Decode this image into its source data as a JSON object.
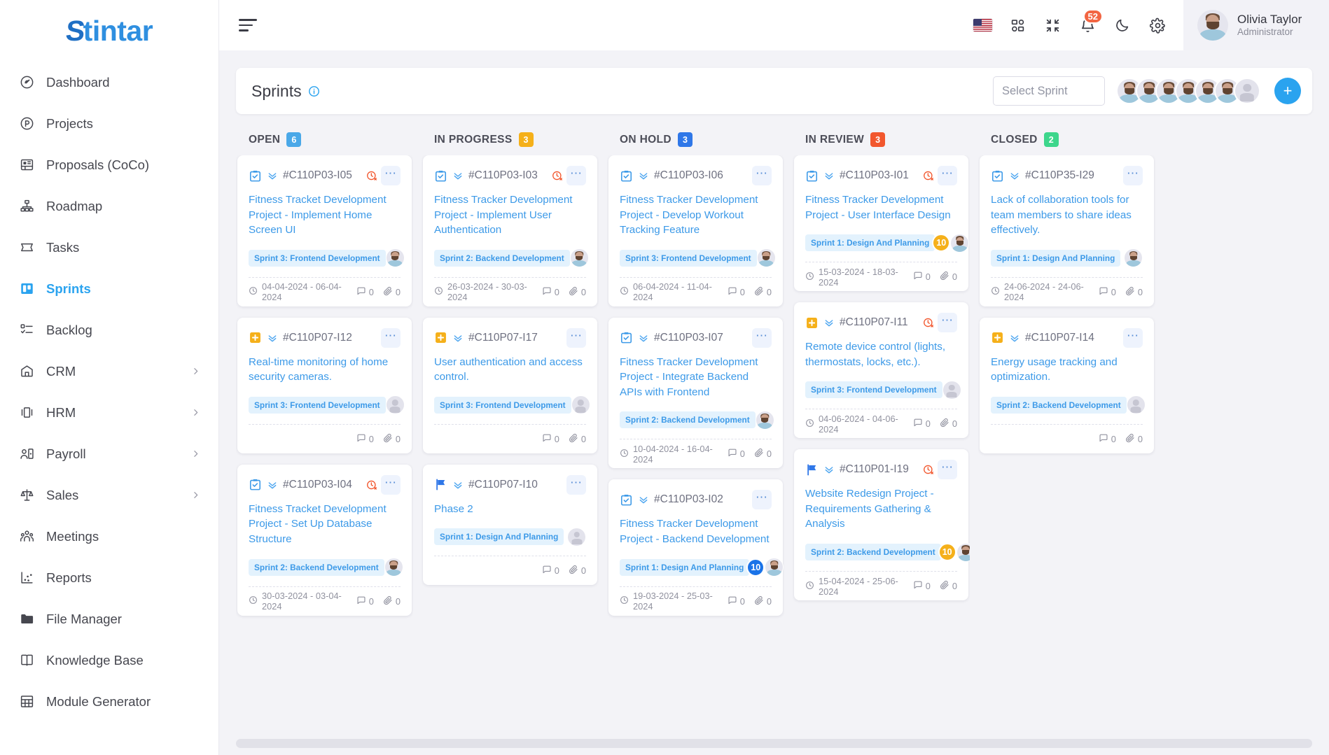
{
  "brand": {
    "logo_mark": "S",
    "logo_text": "tintar",
    "accent": "#2aa3ef"
  },
  "sidebar": {
    "items": [
      {
        "label": "Dashboard",
        "icon": "speedometer-icon",
        "active": false,
        "expandable": false
      },
      {
        "label": "Projects",
        "icon": "projects-icon",
        "active": false,
        "expandable": false
      },
      {
        "label": "Proposals (CoCo)",
        "icon": "proposals-icon",
        "active": false,
        "expandable": false
      },
      {
        "label": "Roadmap",
        "icon": "roadmap-icon",
        "active": false,
        "expandable": false
      },
      {
        "label": "Tasks",
        "icon": "tasks-icon",
        "active": false,
        "expandable": false
      },
      {
        "label": "Sprints",
        "icon": "sprints-board-icon",
        "active": true,
        "expandable": false
      },
      {
        "label": "Backlog",
        "icon": "backlog-icon",
        "active": false,
        "expandable": false
      },
      {
        "label": "CRM",
        "icon": "crm-icon",
        "active": false,
        "expandable": true
      },
      {
        "label": "HRM",
        "icon": "hrm-icon",
        "active": false,
        "expandable": true
      },
      {
        "label": "Payroll",
        "icon": "payroll-icon",
        "active": false,
        "expandable": true
      },
      {
        "label": "Sales",
        "icon": "sales-scale-icon",
        "active": false,
        "expandable": true
      },
      {
        "label": "Meetings",
        "icon": "meetings-icon",
        "active": false,
        "expandable": false
      },
      {
        "label": "Reports",
        "icon": "reports-icon",
        "active": false,
        "expandable": false
      },
      {
        "label": "File Manager",
        "icon": "folder-icon",
        "active": false,
        "expandable": false
      },
      {
        "label": "Knowledge Base",
        "icon": "knowledge-base-icon",
        "active": false,
        "expandable": false
      },
      {
        "label": "Module Generator",
        "icon": "module-generator-icon",
        "active": false,
        "expandable": false
      }
    ]
  },
  "topbar": {
    "menu_toggle": "hamburger-icon",
    "language_flag": "us-flag-icon",
    "apps_icon": "grid-apps-icon",
    "fullscreen_icon": "compress-icon",
    "notifications_icon": "bell-icon",
    "notifications_count": "52",
    "dark_mode_icon": "moon-icon",
    "settings_icon": "gear-icon",
    "profile": {
      "name": "Olivia Taylor",
      "role": "Administrator",
      "avatar": "user-avatar"
    }
  },
  "sprint_bar": {
    "title": "Sprints",
    "info_icon": "info-circle-icon",
    "select_placeholder": "Select Sprint",
    "member_count": 6,
    "add_label": "+"
  },
  "board": {
    "columns": [
      {
        "title": "OPEN",
        "count": "6",
        "badge_color": "#4aa8e8",
        "cards": [
          {
            "type": "task-checkbox-icon",
            "id": "#C110P03-I05",
            "overdue": true,
            "title": "Fitness Tracket Development Project - Implement Home Screen UI",
            "sprint_tag": "Sprint 3: Frontend Development",
            "count_badge": null,
            "badge_color": "",
            "assignee": "user-avatar",
            "date": "04-04-2024 - 06-04-2024",
            "comments": "0",
            "attachments": "0"
          },
          {
            "type": "plus-square-icon",
            "id": "#C110P07-I12",
            "overdue": false,
            "title": "Real-time monitoring of home security cameras.",
            "sprint_tag": "Sprint 3: Frontend Development",
            "count_badge": null,
            "badge_color": "",
            "assignee": "ghost-avatar",
            "date": "",
            "comments": "0",
            "attachments": "0"
          },
          {
            "type": "task-checkbox-icon",
            "id": "#C110P03-I04",
            "overdue": true,
            "title": "Fitness Tracket Development Project - Set Up Database Structure",
            "sprint_tag": "Sprint 2: Backend Development",
            "count_badge": null,
            "badge_color": "",
            "assignee": "user-avatar",
            "date": "30-03-2024 - 03-04-2024",
            "comments": "0",
            "attachments": "0"
          }
        ]
      },
      {
        "title": "IN PROGRESS",
        "count": "3",
        "badge_color": "#f5b01a",
        "cards": [
          {
            "type": "task-checkbox-icon",
            "id": "#C110P03-I03",
            "overdue": true,
            "title": "Fitness Tracker Development Project - Implement User Authentication",
            "sprint_tag": "Sprint 2: Backend Development",
            "count_badge": null,
            "badge_color": "",
            "assignee": "user-avatar",
            "date": "26-03-2024 - 30-03-2024",
            "comments": "0",
            "attachments": "0"
          },
          {
            "type": "plus-square-icon",
            "id": "#C110P07-I17",
            "overdue": false,
            "title": "User authentication and access control.",
            "sprint_tag": "Sprint 3: Frontend Development",
            "count_badge": null,
            "badge_color": "",
            "assignee": "ghost-avatar",
            "date": "",
            "comments": "0",
            "attachments": "0"
          },
          {
            "type": "flag-icon",
            "id": "#C110P07-I10",
            "overdue": false,
            "title": "Phase 2",
            "sprint_tag": "Sprint 1: Design And Planning",
            "count_badge": null,
            "badge_color": "",
            "assignee": "ghost-avatar",
            "date": "",
            "comments": "0",
            "attachments": "0"
          }
        ]
      },
      {
        "title": "ON HOLD",
        "count": "3",
        "badge_color": "#2f77e8",
        "cards": [
          {
            "type": "task-checkbox-icon",
            "id": "#C110P03-I06",
            "overdue": false,
            "title": "Fitness Tracker Development Project - Develop Workout Tracking Feature",
            "sprint_tag": "Sprint 3: Frontend Development",
            "count_badge": null,
            "badge_color": "",
            "assignee": "user-avatar",
            "date": "06-04-2024 - 11-04-2024",
            "comments": "0",
            "attachments": "0"
          },
          {
            "type": "task-checkbox-icon",
            "id": "#C110P03-I07",
            "overdue": false,
            "title": "Fitness Tracker Development Project - Integrate Backend APIs with Frontend",
            "sprint_tag": "Sprint 2: Backend Development",
            "count_badge": null,
            "badge_color": "",
            "assignee": "user-avatar",
            "date": "10-04-2024 - 16-04-2024",
            "comments": "0",
            "attachments": "0"
          },
          {
            "type": "task-checkbox-icon",
            "id": "#C110P03-I02",
            "overdue": false,
            "title": "Fitness Tracker Development Project - Backend Development",
            "sprint_tag": "Sprint 1: Design And Planning",
            "count_badge": "10",
            "badge_color": "blue",
            "assignee": "user-avatar",
            "date": "19-03-2024 - 25-03-2024",
            "comments": "0",
            "attachments": "0"
          }
        ]
      },
      {
        "title": "IN REVIEW",
        "count": "3",
        "badge_color": "#f2572e",
        "cards": [
          {
            "type": "task-checkbox-icon",
            "id": "#C110P03-I01",
            "overdue": true,
            "title": "Fitness Tracker Development Project - User Interface Design",
            "sprint_tag": "Sprint 1: Design And Planning",
            "count_badge": "10",
            "badge_color": "orange",
            "assignee": "user-avatar",
            "date": "15-03-2024 - 18-03-2024",
            "comments": "0",
            "attachments": "0"
          },
          {
            "type": "plus-square-icon",
            "id": "#C110P07-I11",
            "overdue": true,
            "title": "Remote device control (lights, thermostats, locks, etc.).",
            "sprint_tag": "Sprint 3: Frontend Development",
            "count_badge": null,
            "badge_color": "",
            "assignee": "ghost-avatar",
            "date": "04-06-2024 - 04-06-2024",
            "comments": "0",
            "attachments": "0"
          },
          {
            "type": "flag-icon",
            "id": "#C110P01-I19",
            "overdue": true,
            "title": "Website Redesign Project - Requirements Gathering & Analysis",
            "sprint_tag": "Sprint 2: Backend Development",
            "count_badge": "10",
            "badge_color": "orange",
            "assignee": "user-avatar",
            "date": "15-04-2024 - 25-06-2024",
            "comments": "0",
            "attachments": "0"
          }
        ]
      },
      {
        "title": "CLOSED",
        "count": "2",
        "badge_color": "#3dd68c",
        "cards": [
          {
            "type": "task-checkbox-icon",
            "id": "#C110P35-I29",
            "overdue": false,
            "title": "Lack of collaboration tools for team members to share ideas effectively.",
            "sprint_tag": "Sprint 1: Design And Planning",
            "count_badge": null,
            "badge_color": "",
            "assignee": "user-avatar",
            "date": "24-06-2024 - 24-06-2024",
            "comments": "0",
            "attachments": "0"
          },
          {
            "type": "plus-square-icon",
            "id": "#C110P07-I14",
            "overdue": false,
            "title": "Energy usage tracking and optimization.",
            "sprint_tag": "Sprint 2: Backend Development",
            "count_badge": null,
            "badge_color": "",
            "assignee": "ghost-avatar",
            "date": "",
            "comments": "0",
            "attachments": "0"
          }
        ]
      }
    ]
  }
}
